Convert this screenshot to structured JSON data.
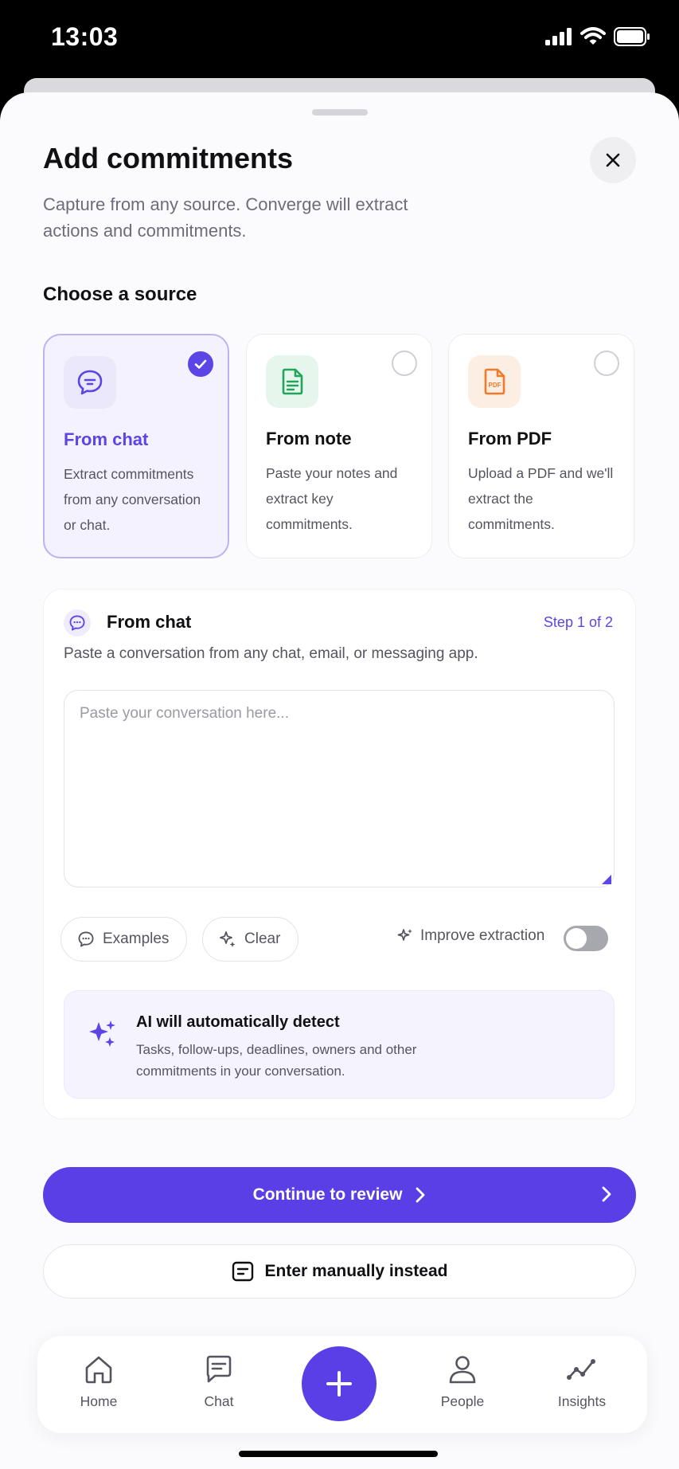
{
  "status": {
    "time": "13:03"
  },
  "header": {
    "title": "Add commitments",
    "subtitle": "Capture from any source. Converge will extract actions and commitments."
  },
  "source_section": {
    "heading": "Choose a source",
    "options": [
      {
        "title": "From chat",
        "desc": "Extract commitments from any conversation or chat.",
        "icon": "chat-bubble-icon",
        "selected": true,
        "accent": "#5b45e6",
        "icon_bg": "#ebe8fb"
      },
      {
        "title": "From note",
        "desc": "Paste your notes and extract key commitments.",
        "icon": "note-document-icon",
        "selected": false,
        "accent": "#22a55a",
        "icon_bg": "#e6f6ec"
      },
      {
        "title": "From PDF",
        "desc": "Upload a PDF and we'll extract the commitments.",
        "icon": "pdf-file-icon",
        "selected": false,
        "accent": "#f07a2a",
        "icon_bg": "#fdeee3"
      }
    ]
  },
  "panel": {
    "title": "From chat",
    "step": "Step 1 of 2",
    "description": "Paste a conversation from any chat, email, or messaging app.",
    "input_placeholder": "Paste your conversation here...",
    "input_value": "",
    "examples_label": "Examples",
    "clear_label": "Clear",
    "improve_label": "Improve extraction",
    "improve_enabled": false,
    "ai_title": "AI will automatically detect",
    "ai_desc": "Tasks, follow-ups, deadlines, owners and other commitments in your conversation."
  },
  "actions": {
    "primary_label": "Continue to review",
    "secondary_label": "Enter manually instead"
  },
  "tabbar": {
    "tabs": [
      {
        "label": "Home",
        "icon": "home-icon"
      },
      {
        "label": "Chat",
        "icon": "chat-icon"
      },
      {
        "label": "",
        "icon": "plus-icon"
      },
      {
        "label": "People",
        "icon": "person-icon"
      },
      {
        "label": "Insights",
        "icon": "trend-line-icon"
      }
    ]
  },
  "colors": {
    "accent": "#5b3fe6",
    "text": "#111114",
    "muted": "#55555f"
  }
}
